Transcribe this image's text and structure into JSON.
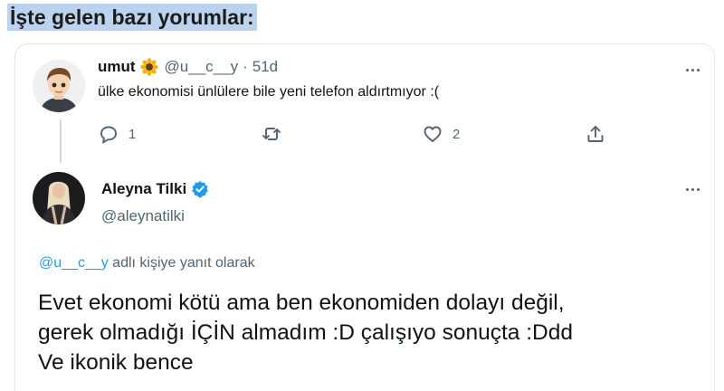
{
  "heading": "İşte gelen bazı yorumlar:",
  "tweet1": {
    "name": "umut",
    "emoji": "sunflower",
    "handle": "@u__c__y",
    "separator": "·",
    "time": "51d",
    "text": "ülke ekonomisi ünlülere bile yeni telefon aldırtmıyor :(",
    "replies": "1",
    "retweets": "",
    "likes": "2"
  },
  "tweet2": {
    "name": "Aleyna Tilki",
    "handle": "@aleynatilki",
    "verified": true,
    "reply_handle": "@u__c__y",
    "reply_suffix": " adlı kişiye yanıt olarak",
    "lines": [
      "Evet ekonomi kötü ama ben ekonomiden dolayı değil,",
      "gerek olmadığı İÇİN almadım :D çalışıyo sonuçta :Ddd",
      "Ve ikonik bence"
    ]
  },
  "colors": {
    "heading_highlight": "#bcd3f0",
    "text_primary": "#0f1419",
    "text_secondary": "#536471",
    "link": "#1d9bf0",
    "border": "#e3e7ea"
  }
}
